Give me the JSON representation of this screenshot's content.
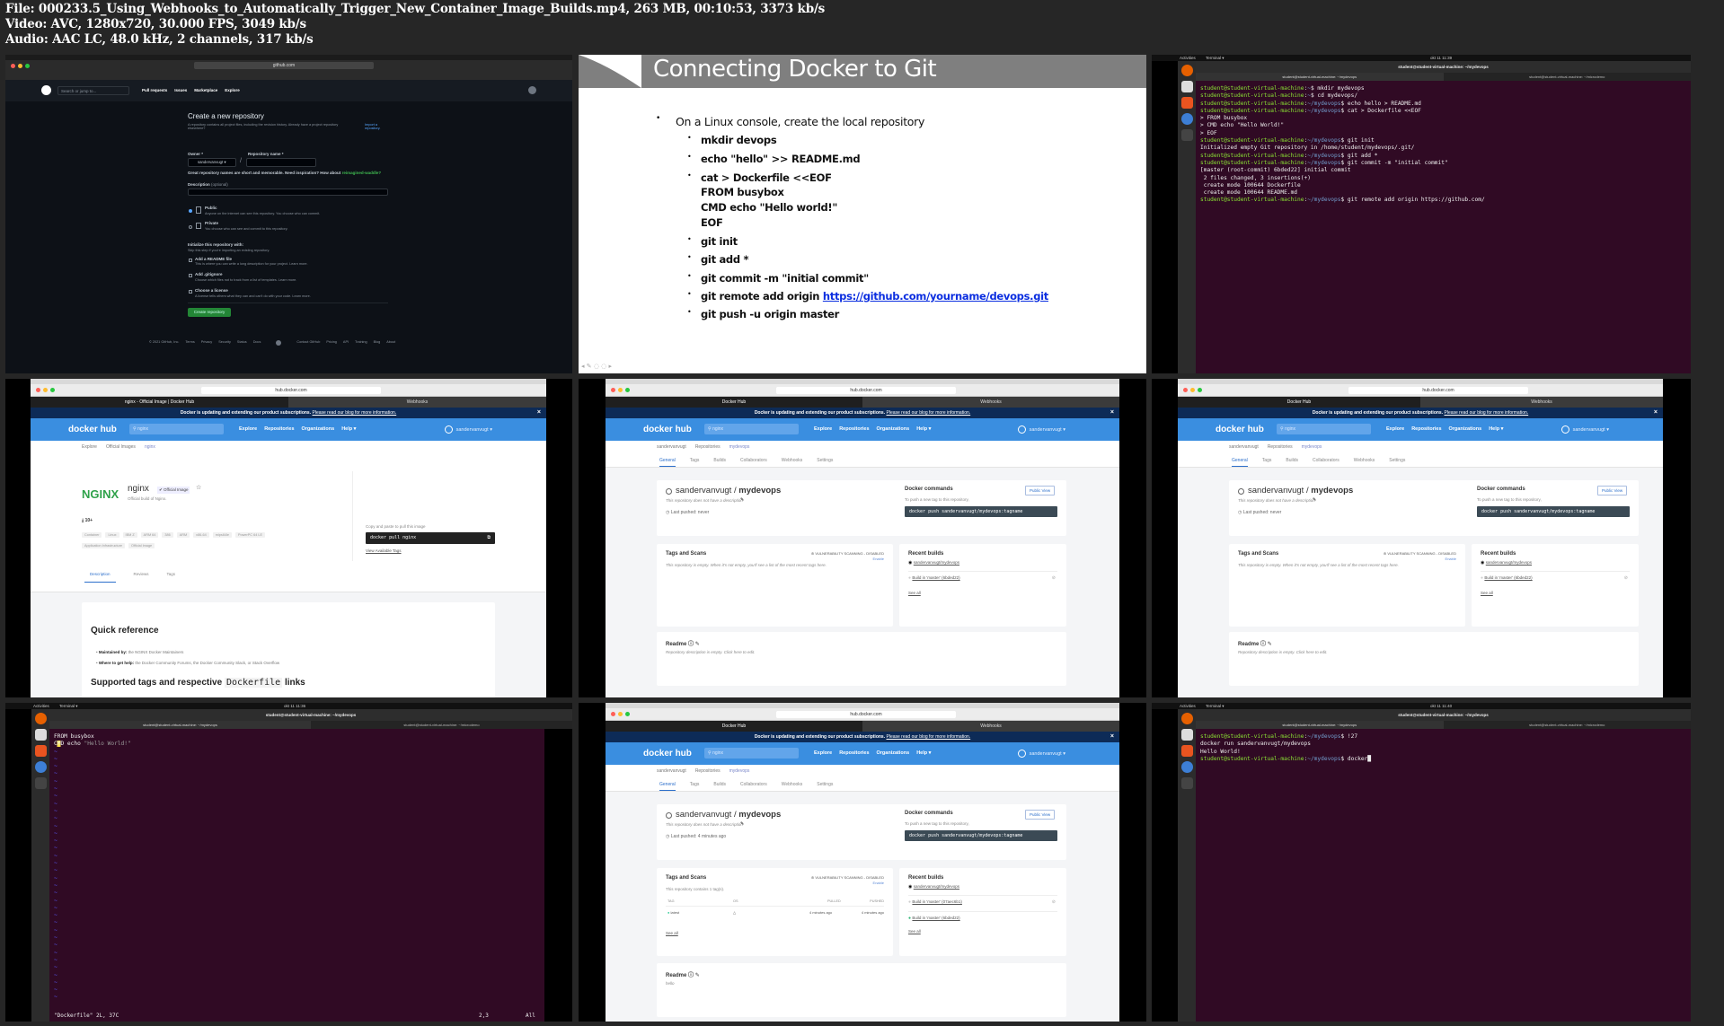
{
  "header": {
    "file": "File: 000233.5_Using_Webhooks_to_Automatically_Trigger_New_Container_Image_Builds.mp4, 263 MB, 00:10:53, 3373 kb/s",
    "video": "Video: AVC, 1280x720, 30.000 FPS, 3049 kb/s",
    "audio": "Audio: AAC LC, 48.0 kHz, 2 channels, 317 kb/s"
  },
  "github": {
    "address": "github.com",
    "search": "Search or jump to...",
    "nav": [
      "Pull requests",
      "Issues",
      "Marketplace",
      "Explore"
    ],
    "title": "Create a new repository",
    "intro": "A repository contains all project files, including the revision history. Already have a project repository elsewhere?",
    "import_link": "Import a repository.",
    "owner_label": "Owner *",
    "owner_value": "sandervanvugt ▾",
    "repo_label": "Repository name *",
    "hint": "Great repository names are short and memorable. Need inspiration? How about",
    "hint_suggestion": "reimagined-waddle?",
    "desc_label": "Description",
    "desc_optional": "(optional)",
    "public_label": "Public",
    "public_sub": "Anyone on the internet can see this repository. You choose who can commit.",
    "private_label": "Private",
    "private_sub": "You choose who can see and commit to this repository.",
    "init_title": "Initialize this repository with:",
    "init_sub": "Skip this step if you're importing an existing repository.",
    "readme_label": "Add a README file",
    "readme_sub": "This is where you can write a long description for your project. Learn more.",
    "gitignore_label": "Add .gitignore",
    "gitignore_sub": "Choose which files not to track from a list of templates. Learn more.",
    "license_label": "Choose a license",
    "license_sub": "A license tells others what they can and can't do with your code. Learn more.",
    "create_button": "Create repository",
    "footer_left": [
      "© 2021 GitHub, Inc.",
      "Terms",
      "Privacy",
      "Security",
      "Status",
      "Docs"
    ],
    "footer_right": [
      "Contact GitHub",
      "Pricing",
      "API",
      "Training",
      "Blog",
      "About"
    ]
  },
  "slide": {
    "title": "Connecting Docker to Git",
    "main_bullet": "On a Linux console, create the local repository",
    "items": [
      "mkdir devops",
      "echo \"hello\" >> README.md",
      "cat > Dockerfile <<EOF",
      "FROM busybox",
      "CMD echo \"Hello world!\"",
      "EOF",
      "git init",
      "git add *",
      "git commit -m \"initial commit\"",
      "git remote add origin",
      "git push -u origin master"
    ],
    "link": "https://github.com/yourname/devops.git"
  },
  "terminal1": {
    "activities": "Activities",
    "app": "Terminal ▾",
    "clock": "okt 11  11:39",
    "title": "student@student-virtual-machine: ~/mydevops",
    "tabs": [
      "student@student-virtual-machine: ~/mydevops",
      "student@student-virtual-machine: ~/microdemo"
    ],
    "lines": [
      {
        "u": "student@student-virtual-machine",
        "p": "~",
        "c": "$ mkdir mydevops"
      },
      {
        "u": "student@student-virtual-machine",
        "p": "~",
        "c": "$ cd mydevops/"
      },
      {
        "u": "student@student-virtual-machine",
        "p": "~/mydevops",
        "c": "$ echo hello > README.md"
      },
      {
        "u": "student@student-virtual-machine",
        "p": "~/mydevops",
        "c": "$ cat > Dockerfile <<EOF"
      },
      {
        "o": "> FROM busybox"
      },
      {
        "o": "> CMD echo \"Hello World!\""
      },
      {
        "o": "> EOF"
      },
      {
        "u": "student@student-virtual-machine",
        "p": "~/mydevops",
        "c": "$ git init"
      },
      {
        "o": "Initialized empty Git repository in /home/student/mydevops/.git/"
      },
      {
        "u": "student@student-virtual-machine",
        "p": "~/mydevops",
        "c": "$ git add *"
      },
      {
        "u": "student@student-virtual-machine",
        "p": "~/mydevops",
        "c": "$ git commit -m \"initial commit\""
      },
      {
        "o": "[master (root-commit) 6bded22] initial commit"
      },
      {
        "o": " 2 files changed, 3 insertions(+)"
      },
      {
        "o": " create mode 100644 Dockerfile"
      },
      {
        "o": " create mode 100644 README.md"
      },
      {
        "u": "student@student-virtual-machine",
        "p": "~/mydevops",
        "c": "$ git remote add origin https://github.com/"
      }
    ]
  },
  "nginx": {
    "address": "hub.docker.com",
    "tabs": [
      "nginx - Official Image | Docker Hub",
      "Webhooks"
    ],
    "notice": "Docker is updating and extending our product subscriptions.",
    "notice_link": "Please read our blog for more information.",
    "logo": "docker hub",
    "search": "nginx",
    "nav": [
      "Explore",
      "Repositories",
      "Organizations",
      "Help ▾"
    ],
    "user": "sandervanvugt ▾",
    "breadcrumb": [
      "Explore",
      "Official Images",
      "nginx"
    ],
    "brand_logo": "NGINX",
    "name": "nginx",
    "badge": "Official Image",
    "subtitle": "Official build of Nginx.",
    "downloads": "10+",
    "chips": [
      "Container",
      "Linux",
      "IBM Z",
      "ARM 64",
      "386",
      "ARM",
      "x86-64",
      "mips64le",
      "PowerPC 64 LE"
    ],
    "chips2": [
      "Application Infrastructure",
      "Official Image"
    ],
    "copy_label": "Copy and paste to pull this image",
    "pull_cmd": "docker pull nginx",
    "view_tags": "View Available Tags",
    "tabs_row": [
      "Description",
      "Reviews",
      "Tags"
    ],
    "quick_ref": "Quick reference",
    "maintained_label": "Maintained by:",
    "maintained_value": "the NGINX Docker Maintainers",
    "help_label": "Where to get help:",
    "help_value": "the Docker Community Forums, the Docker Community Slack, or Stack Overflow",
    "supported_a": "Supported tags and respective",
    "supported_code": "Dockerfile",
    "supported_b": "links"
  },
  "repo": {
    "address": "hub.docker.com",
    "tabs": [
      "Docker Hub",
      "Webhooks"
    ],
    "notice": "Docker is updating and extending our product subscriptions.",
    "notice_link": "Please read our blog for more information.",
    "logo": "docker hub",
    "search": "nginx",
    "nav": [
      "Explore",
      "Repositories",
      "Organizations",
      "Help ▾"
    ],
    "user": "sandervanvugt ▾",
    "breadcrumb": [
      "sandervanvugt",
      "Repositories",
      "mydevops"
    ],
    "repo_tabs": [
      "General",
      "Tags",
      "Builds",
      "Collaborators",
      "Webhooks",
      "Settings"
    ],
    "owner": "sandervanvugt / ",
    "name": "mydevops",
    "no_desc": "This repository does not have a description",
    "docker_commands": "Docker commands",
    "public_view": "Public View",
    "push_hint": "To push a new tag to this repository,",
    "push_cmd": "docker push sandervanvugt/mydevops:tagname",
    "tags_title": "Tags and Scans",
    "vuln": "VULNERABILITY SCANNING - DISABLED",
    "enable": "Enable",
    "recent_builds": "Recent builds",
    "source": "sandervanvugt/mydevops",
    "see_all": "See all",
    "readme": "Readme",
    "close": "×"
  },
  "repo1": {
    "last_pushed": "Last pushed: never",
    "empty": "This repository is empty. When it's not empty, you'll see a list of the most recent tags here.",
    "builds": [
      "Build in 'master' (6bded22)"
    ],
    "readme_text": "Repository description is empty. Click here to edit."
  },
  "repo3": {
    "last_pushed": "Last pushed: 4 minutes ago",
    "contains": "This repository contains 1 tag(s).",
    "cols": [
      "TAG",
      "OS",
      "PULLED",
      "PUSHED"
    ],
    "row": {
      "tag": "latest",
      "pulled": "4 minutes ago",
      "pushed": "4 minutes ago"
    },
    "builds": [
      "Build in 'master' (07aec6b1)",
      "Build in 'master' (6bded22)"
    ],
    "readme_text": "hello"
  },
  "vim": {
    "activities": "Activities",
    "app": "Terminal ▾",
    "clock": "okt 11  11:36",
    "title": "student@student-virtual-machine: ~/mydevops",
    "tabs": [
      "student@student-virtual-machine: ~/mydevops",
      "student@student-virtual-machine: ~/microdemo"
    ],
    "line1": "FROM busybox",
    "line2_kw": "CMD",
    "line2_cmd": " echo ",
    "line2_str": "\"Hello World!\"",
    "status_file": "\"Dockerfile\" 2L, 37C",
    "status_pos": "2,3",
    "status_scroll": "All"
  },
  "terminal2": {
    "activities": "Activities",
    "app": "Terminal ▾",
    "clock": "okt 11  11:40",
    "title": "student@student-virtual-machine: ~/mydevops",
    "tabs": [
      "student@student-virtual-machine: ~/mydevops",
      "student@student-virtual-machine: ~/microdemo"
    ],
    "lines": [
      {
        "u": "student@student-virtual-machine",
        "p": "~/mydevops",
        "c": "$ !27"
      },
      {
        "o": "docker run sandervanvugt/mydevops"
      },
      {
        "o": "Hello World!"
      },
      {
        "u": "student@student-virtual-machine",
        "p": "~/mydevops",
        "c": "$ docker█"
      }
    ]
  },
  "colors": {
    "docker_blue": "#3a8ee0",
    "notice_navy": "#0d2b57",
    "terminal_bg": "#300a24",
    "github_bg": "#0d1117",
    "link_blue": "#0b2ee0"
  }
}
